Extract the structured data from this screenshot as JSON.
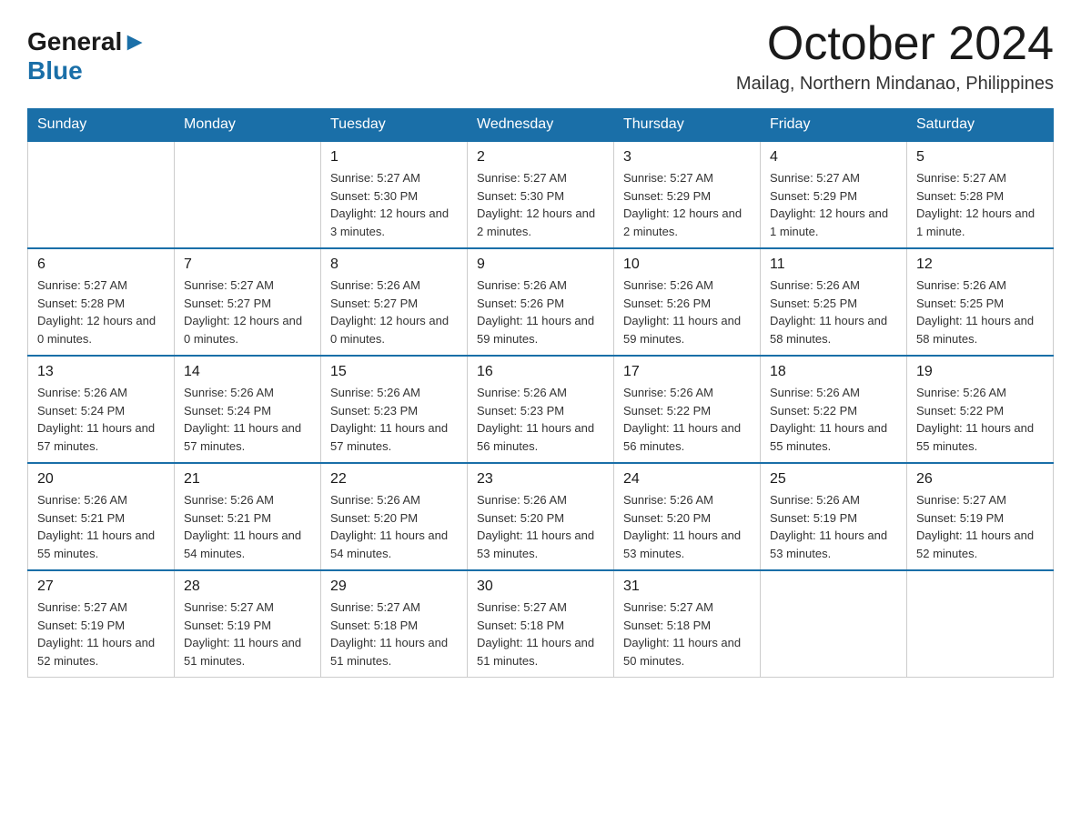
{
  "logo": {
    "general": "General",
    "blue": "Blue"
  },
  "title": "October 2024",
  "location": "Mailag, Northern Mindanao, Philippines",
  "days_header": [
    "Sunday",
    "Monday",
    "Tuesday",
    "Wednesday",
    "Thursday",
    "Friday",
    "Saturday"
  ],
  "weeks": [
    [
      {
        "day": "",
        "sunrise": "",
        "sunset": "",
        "daylight": ""
      },
      {
        "day": "",
        "sunrise": "",
        "sunset": "",
        "daylight": ""
      },
      {
        "day": "1",
        "sunrise": "Sunrise: 5:27 AM",
        "sunset": "Sunset: 5:30 PM",
        "daylight": "Daylight: 12 hours and 3 minutes."
      },
      {
        "day": "2",
        "sunrise": "Sunrise: 5:27 AM",
        "sunset": "Sunset: 5:30 PM",
        "daylight": "Daylight: 12 hours and 2 minutes."
      },
      {
        "day": "3",
        "sunrise": "Sunrise: 5:27 AM",
        "sunset": "Sunset: 5:29 PM",
        "daylight": "Daylight: 12 hours and 2 minutes."
      },
      {
        "day": "4",
        "sunrise": "Sunrise: 5:27 AM",
        "sunset": "Sunset: 5:29 PM",
        "daylight": "Daylight: 12 hours and 1 minute."
      },
      {
        "day": "5",
        "sunrise": "Sunrise: 5:27 AM",
        "sunset": "Sunset: 5:28 PM",
        "daylight": "Daylight: 12 hours and 1 minute."
      }
    ],
    [
      {
        "day": "6",
        "sunrise": "Sunrise: 5:27 AM",
        "sunset": "Sunset: 5:28 PM",
        "daylight": "Daylight: 12 hours and 0 minutes."
      },
      {
        "day": "7",
        "sunrise": "Sunrise: 5:27 AM",
        "sunset": "Sunset: 5:27 PM",
        "daylight": "Daylight: 12 hours and 0 minutes."
      },
      {
        "day": "8",
        "sunrise": "Sunrise: 5:26 AM",
        "sunset": "Sunset: 5:27 PM",
        "daylight": "Daylight: 12 hours and 0 minutes."
      },
      {
        "day": "9",
        "sunrise": "Sunrise: 5:26 AM",
        "sunset": "Sunset: 5:26 PM",
        "daylight": "Daylight: 11 hours and 59 minutes."
      },
      {
        "day": "10",
        "sunrise": "Sunrise: 5:26 AM",
        "sunset": "Sunset: 5:26 PM",
        "daylight": "Daylight: 11 hours and 59 minutes."
      },
      {
        "day": "11",
        "sunrise": "Sunrise: 5:26 AM",
        "sunset": "Sunset: 5:25 PM",
        "daylight": "Daylight: 11 hours and 58 minutes."
      },
      {
        "day": "12",
        "sunrise": "Sunrise: 5:26 AM",
        "sunset": "Sunset: 5:25 PM",
        "daylight": "Daylight: 11 hours and 58 minutes."
      }
    ],
    [
      {
        "day": "13",
        "sunrise": "Sunrise: 5:26 AM",
        "sunset": "Sunset: 5:24 PM",
        "daylight": "Daylight: 11 hours and 57 minutes."
      },
      {
        "day": "14",
        "sunrise": "Sunrise: 5:26 AM",
        "sunset": "Sunset: 5:24 PM",
        "daylight": "Daylight: 11 hours and 57 minutes."
      },
      {
        "day": "15",
        "sunrise": "Sunrise: 5:26 AM",
        "sunset": "Sunset: 5:23 PM",
        "daylight": "Daylight: 11 hours and 57 minutes."
      },
      {
        "day": "16",
        "sunrise": "Sunrise: 5:26 AM",
        "sunset": "Sunset: 5:23 PM",
        "daylight": "Daylight: 11 hours and 56 minutes."
      },
      {
        "day": "17",
        "sunrise": "Sunrise: 5:26 AM",
        "sunset": "Sunset: 5:22 PM",
        "daylight": "Daylight: 11 hours and 56 minutes."
      },
      {
        "day": "18",
        "sunrise": "Sunrise: 5:26 AM",
        "sunset": "Sunset: 5:22 PM",
        "daylight": "Daylight: 11 hours and 55 minutes."
      },
      {
        "day": "19",
        "sunrise": "Sunrise: 5:26 AM",
        "sunset": "Sunset: 5:22 PM",
        "daylight": "Daylight: 11 hours and 55 minutes."
      }
    ],
    [
      {
        "day": "20",
        "sunrise": "Sunrise: 5:26 AM",
        "sunset": "Sunset: 5:21 PM",
        "daylight": "Daylight: 11 hours and 55 minutes."
      },
      {
        "day": "21",
        "sunrise": "Sunrise: 5:26 AM",
        "sunset": "Sunset: 5:21 PM",
        "daylight": "Daylight: 11 hours and 54 minutes."
      },
      {
        "day": "22",
        "sunrise": "Sunrise: 5:26 AM",
        "sunset": "Sunset: 5:20 PM",
        "daylight": "Daylight: 11 hours and 54 minutes."
      },
      {
        "day": "23",
        "sunrise": "Sunrise: 5:26 AM",
        "sunset": "Sunset: 5:20 PM",
        "daylight": "Daylight: 11 hours and 53 minutes."
      },
      {
        "day": "24",
        "sunrise": "Sunrise: 5:26 AM",
        "sunset": "Sunset: 5:20 PM",
        "daylight": "Daylight: 11 hours and 53 minutes."
      },
      {
        "day": "25",
        "sunrise": "Sunrise: 5:26 AM",
        "sunset": "Sunset: 5:19 PM",
        "daylight": "Daylight: 11 hours and 53 minutes."
      },
      {
        "day": "26",
        "sunrise": "Sunrise: 5:27 AM",
        "sunset": "Sunset: 5:19 PM",
        "daylight": "Daylight: 11 hours and 52 minutes."
      }
    ],
    [
      {
        "day": "27",
        "sunrise": "Sunrise: 5:27 AM",
        "sunset": "Sunset: 5:19 PM",
        "daylight": "Daylight: 11 hours and 52 minutes."
      },
      {
        "day": "28",
        "sunrise": "Sunrise: 5:27 AM",
        "sunset": "Sunset: 5:19 PM",
        "daylight": "Daylight: 11 hours and 51 minutes."
      },
      {
        "day": "29",
        "sunrise": "Sunrise: 5:27 AM",
        "sunset": "Sunset: 5:18 PM",
        "daylight": "Daylight: 11 hours and 51 minutes."
      },
      {
        "day": "30",
        "sunrise": "Sunrise: 5:27 AM",
        "sunset": "Sunset: 5:18 PM",
        "daylight": "Daylight: 11 hours and 51 minutes."
      },
      {
        "day": "31",
        "sunrise": "Sunrise: 5:27 AM",
        "sunset": "Sunset: 5:18 PM",
        "daylight": "Daylight: 11 hours and 50 minutes."
      },
      {
        "day": "",
        "sunrise": "",
        "sunset": "",
        "daylight": ""
      },
      {
        "day": "",
        "sunrise": "",
        "sunset": "",
        "daylight": ""
      }
    ]
  ]
}
